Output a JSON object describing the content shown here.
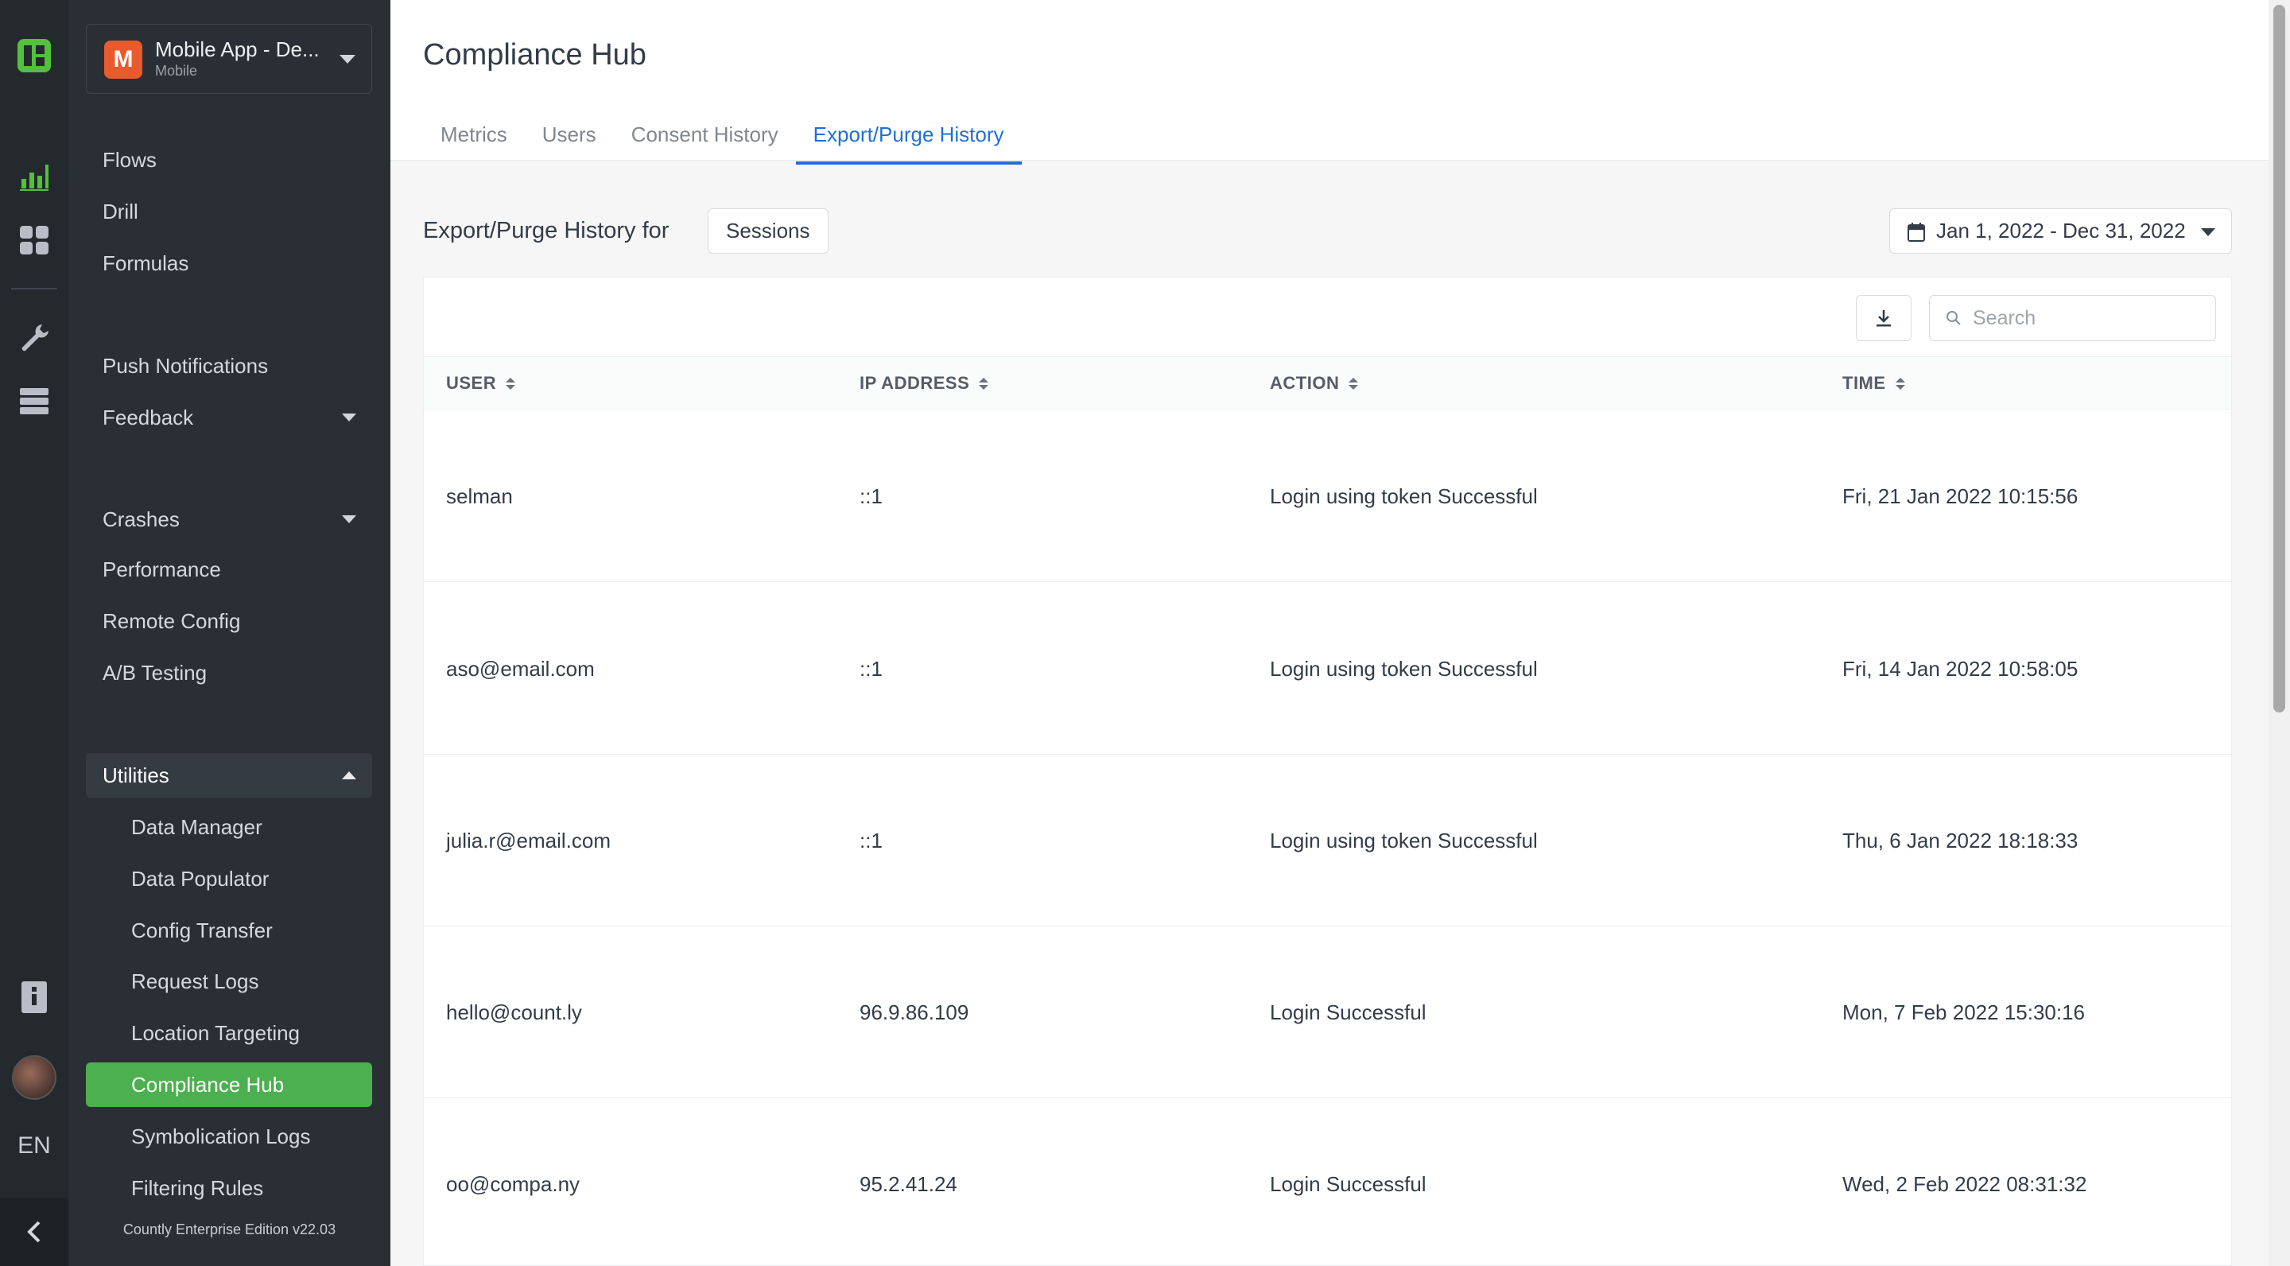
{
  "rail": {
    "icons": [
      "countly-logo-icon",
      "analytics-icon",
      "dashboards-icon",
      "management-icon",
      "data-icon",
      "documentation-icon"
    ],
    "language": "EN"
  },
  "sidebar": {
    "app": {
      "badge": "M",
      "name": "Mobile App - De...",
      "type": "Mobile"
    },
    "items": [
      {
        "label": "Flows"
      },
      {
        "label": "Drill"
      },
      {
        "label": "Formulas"
      },
      {
        "label": "Push Notifications"
      },
      {
        "label": "Feedback"
      },
      {
        "label": "Crashes"
      },
      {
        "label": "Performance"
      },
      {
        "label": "Remote Config"
      },
      {
        "label": "A/B Testing"
      },
      {
        "label": "Utilities"
      }
    ],
    "utilities": [
      {
        "label": "Data Manager"
      },
      {
        "label": "Data Populator"
      },
      {
        "label": "Config Transfer"
      },
      {
        "label": "Request Logs"
      },
      {
        "label": "Location Targeting"
      },
      {
        "label": "Compliance Hub"
      },
      {
        "label": "Symbolication Logs"
      },
      {
        "label": "Filtering Rules"
      }
    ],
    "footer": "Countly Enterprise Edition v22.03"
  },
  "page": {
    "title": "Compliance Hub",
    "tabs": [
      {
        "label": "Metrics"
      },
      {
        "label": "Users"
      },
      {
        "label": "Consent History"
      },
      {
        "label": "Export/Purge History"
      }
    ],
    "active_tab": "Export/Purge History",
    "section_title": "Export/Purge History for",
    "type_select": "Sessions",
    "date_range": "Jan 1, 2022 - Dec 31, 2022",
    "search_placeholder": "Search"
  },
  "table": {
    "columns": [
      "USER",
      "IP ADDRESS",
      "ACTION",
      "TIME"
    ],
    "rows": [
      {
        "user": "selman",
        "ip": "::1",
        "action": "Login using token Successful",
        "time": "Fri, 21 Jan 2022 10:15:56"
      },
      {
        "user": "aso@email.com",
        "ip": "::1",
        "action": "Login using token Successful",
        "time": "Fri, 14 Jan 2022 10:58:05"
      },
      {
        "user": "julia.r@email.com",
        "ip": "::1",
        "action": "Login using token Successful",
        "time": "Thu, 6 Jan 2022 18:18:33"
      },
      {
        "user": "hello@count.ly",
        "ip": "96.9.86.109",
        "action": "Login Successful",
        "time": "Mon, 7 Feb 2022 15:30:16"
      },
      {
        "user": "oo@compa.ny",
        "ip": "95.2.41.24",
        "action": "Login Successful",
        "time": "Wed, 2 Feb 2022 08:31:32"
      }
    ]
  },
  "colors": {
    "accent": "#1F6FD8",
    "active_nav": "#4CAF50",
    "brand_green": "#52C13B",
    "app_badge": "#E95B2C",
    "sidebar_bg": "#2A2F35",
    "rail_bg": "#24292E"
  }
}
